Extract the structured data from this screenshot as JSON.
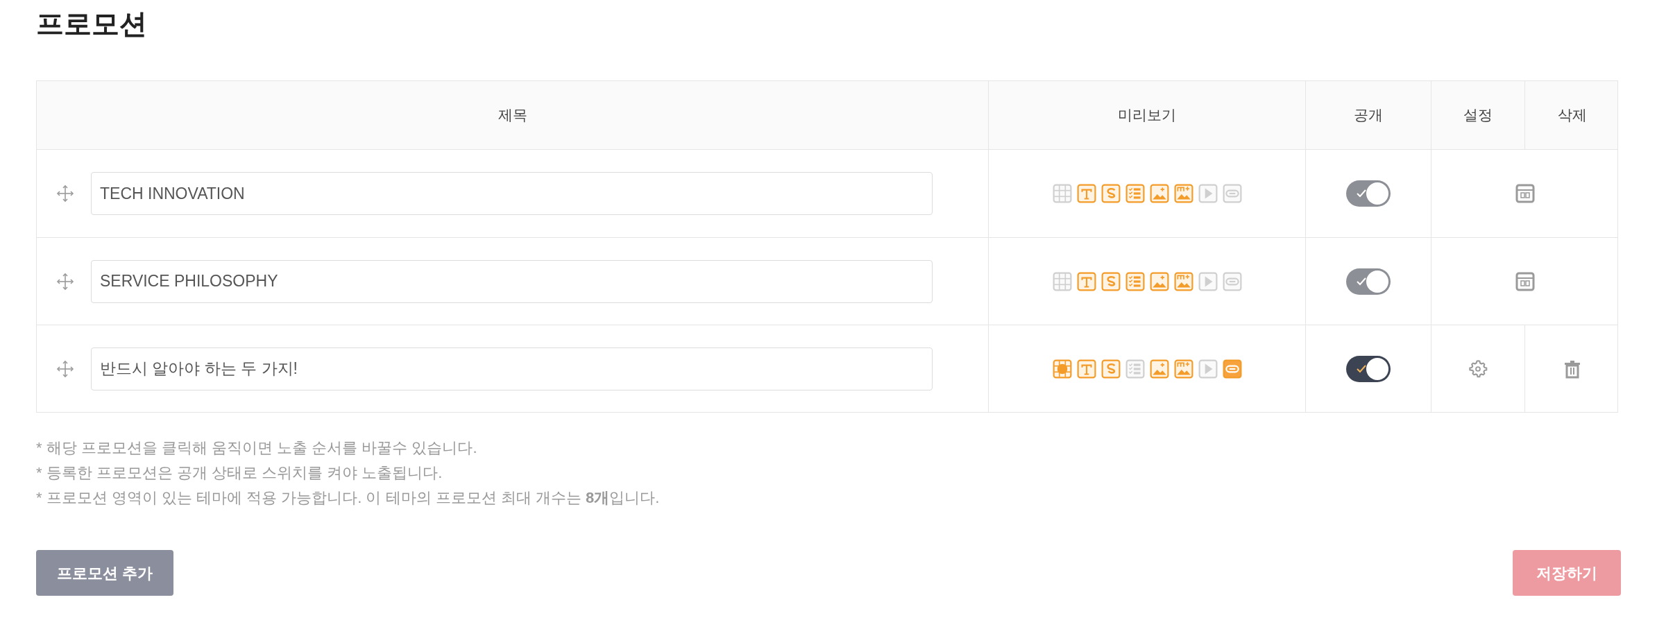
{
  "title": "프로모션",
  "table": {
    "columns": [
      "제목",
      "미리보기",
      "공개",
      "설정",
      "삭제"
    ],
    "rows": [
      {
        "title": "TECH INNOVATION",
        "preview": [
          {
            "kind": "grid",
            "on": false
          },
          {
            "kind": "text",
            "on": true
          },
          {
            "kind": "s",
            "on": true
          },
          {
            "kind": "checklist",
            "on": true
          },
          {
            "kind": "image",
            "on": true
          },
          {
            "kind": "image-plus",
            "on": true
          },
          {
            "kind": "play",
            "on": false
          },
          {
            "kind": "link",
            "on": false
          }
        ],
        "public": {
          "on": true,
          "disabled": true
        },
        "kind": "layout"
      },
      {
        "title": "SERVICE PHILOSOPHY",
        "preview": [
          {
            "kind": "grid",
            "on": false
          },
          {
            "kind": "text",
            "on": true
          },
          {
            "kind": "s",
            "on": true
          },
          {
            "kind": "checklist",
            "on": true
          },
          {
            "kind": "image",
            "on": true
          },
          {
            "kind": "image-plus",
            "on": true
          },
          {
            "kind": "play",
            "on": false
          },
          {
            "kind": "link",
            "on": false
          }
        ],
        "public": {
          "on": true,
          "disabled": true
        },
        "kind": "layout"
      },
      {
        "title": "반드시 알아야 하는 두 가지!",
        "preview": [
          {
            "kind": "grid",
            "on": true
          },
          {
            "kind": "text",
            "on": true
          },
          {
            "kind": "s",
            "on": true
          },
          {
            "kind": "checklist",
            "on": false
          },
          {
            "kind": "image",
            "on": true
          },
          {
            "kind": "image-plus",
            "on": true
          },
          {
            "kind": "play",
            "on": false
          },
          {
            "kind": "link",
            "on": true
          }
        ],
        "public": {
          "on": true,
          "disabled": false
        },
        "kind": "gear-delete"
      }
    ]
  },
  "notes": [
    "* 해당 프로모션을 클릭해 움직이면 노출 순서를 바꿀수 있습니다.",
    "* 등록한 프로모션은 공개 상태로 스위치를 켜야 노출됩니다.",
    "* 프로모션 영역이 있는 테마에 적용 가능합니다. 이 테마의 프로모션 최대 개수는 **8개**입니다."
  ],
  "buttons": {
    "add": "프로모션 추가",
    "save": "저장하기"
  }
}
